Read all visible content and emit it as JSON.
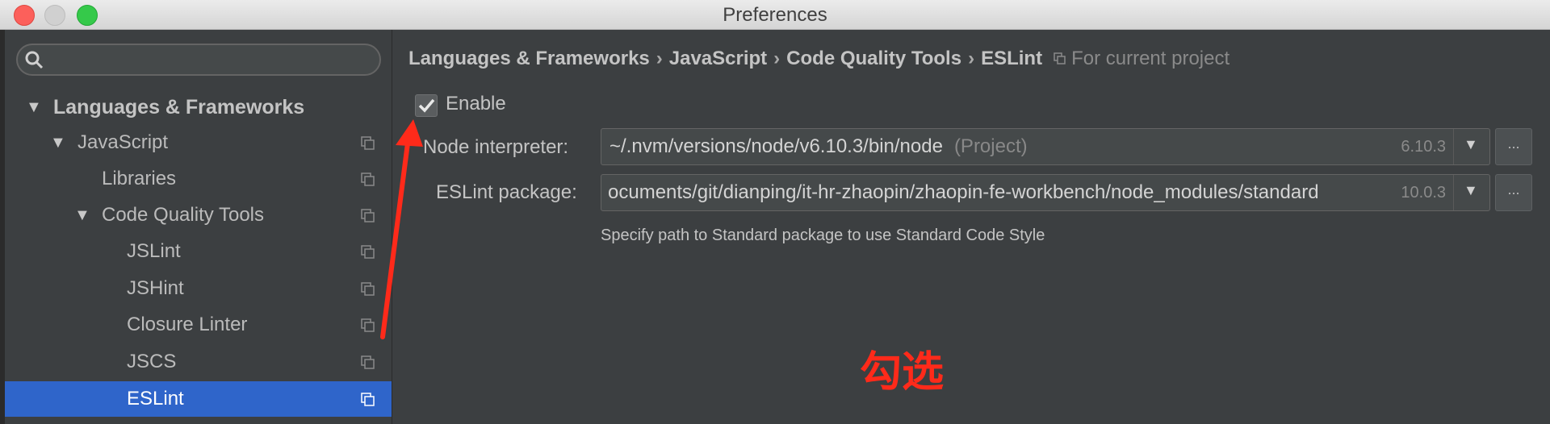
{
  "window": {
    "title": "Preferences"
  },
  "search": {
    "placeholder": ""
  },
  "sidebar": {
    "items": [
      {
        "label": "Languages & Frameworks",
        "expanded": true
      },
      {
        "label": "JavaScript",
        "expanded": true
      },
      {
        "label": "Libraries"
      },
      {
        "label": "Code Quality Tools",
        "expanded": true
      },
      {
        "label": "JSLint"
      },
      {
        "label": "JSHint"
      },
      {
        "label": "Closure Linter"
      },
      {
        "label": "JSCS"
      },
      {
        "label": "ESLint",
        "selected": true
      }
    ]
  },
  "breadcrumb": {
    "items": [
      "Languages & Frameworks",
      "JavaScript",
      "Code Quality Tools",
      "ESLint"
    ],
    "separator": "›",
    "scope": "For current project"
  },
  "enable": {
    "label": "Enable",
    "checked": true
  },
  "node_interpreter": {
    "label": "Node interpreter:",
    "value": "~/.nvm/versions/node/v6.10.3/bin/node",
    "hint": "(Project)",
    "version": "6.10.3"
  },
  "eslint_package": {
    "label": "ESLint package:",
    "value": "ocuments/git/dianping/it-hr-zhaopin/zhaopin-fe-workbench/node_modules/standard",
    "version": "10.0.3"
  },
  "more_label": "...",
  "helper_text": "Specify path to Standard package to use Standard Code Style",
  "annotation": {
    "text": "勾选",
    "color": "#ff2a1a"
  },
  "colors": {
    "selection": "#2f65ca",
    "background": "#3c3f41"
  }
}
